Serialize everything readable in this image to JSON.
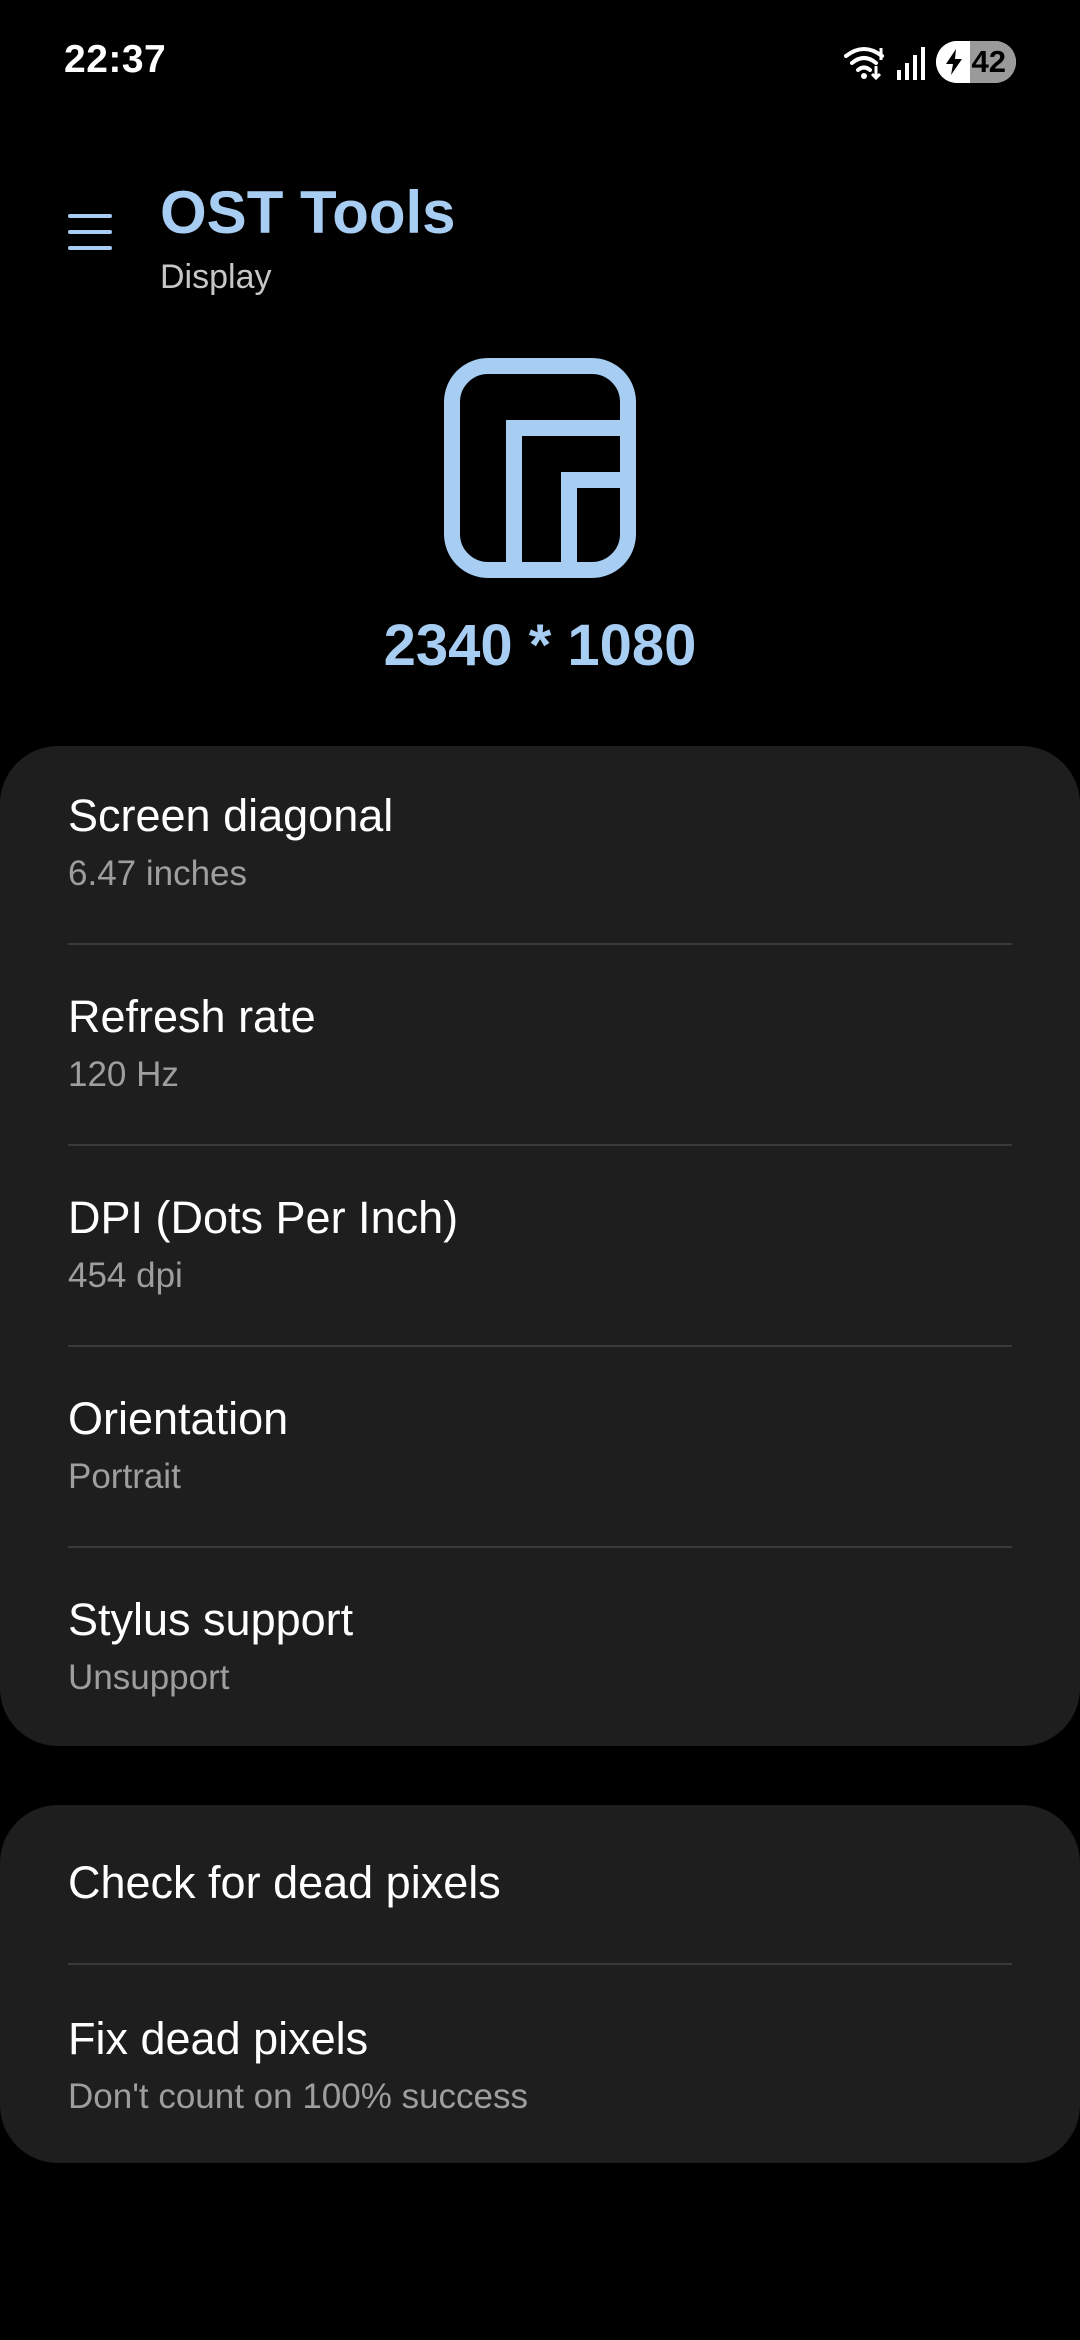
{
  "status_bar": {
    "time": "22:37",
    "battery_level": "42",
    "battery_fraction": 0.42,
    "icons": [
      "wifi-icon",
      "signal-icon",
      "battery-charging-icon"
    ]
  },
  "header": {
    "title": "OST Tools",
    "subtitle": "Display",
    "menu_icon": "hamburger-menu-icon"
  },
  "display": {
    "icon": "display-layout-icon",
    "resolution": "2340 * 1080"
  },
  "info_items": [
    {
      "title": "Screen diagonal",
      "value": "6.47 inches"
    },
    {
      "title": "Refresh rate",
      "value": "120 Hz"
    },
    {
      "title": "DPI (Dots Per Inch)",
      "value": "454 dpi"
    },
    {
      "title": "Orientation",
      "value": "Portrait"
    },
    {
      "title": "Stylus support",
      "value": "Unsupport"
    }
  ],
  "actions": [
    {
      "title": "Check for dead pixels"
    },
    {
      "title": "Fix dead pixels",
      "value": "Don't count on 100% success"
    }
  ],
  "colors": {
    "accent": "#a8cdf2",
    "background": "#000000",
    "card": "#1e1e1e",
    "secondary_text": "#9e9e9e",
    "divider": "#3a3a3a"
  }
}
